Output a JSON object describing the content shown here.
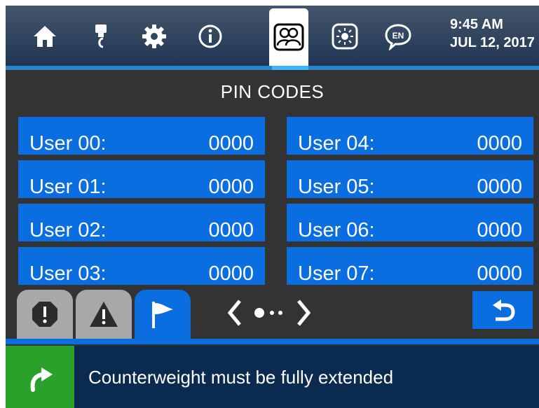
{
  "header": {
    "nav_items": [
      {
        "icon": "home-icon"
      },
      {
        "icon": "tool-icon"
      },
      {
        "icon": "gear-icon"
      },
      {
        "icon": "info-icon"
      },
      {
        "icon": "users-icon",
        "active": true
      },
      {
        "icon": "brightness-icon"
      },
      {
        "icon": "language-icon",
        "text": "EN"
      }
    ],
    "time": "9:45 AM",
    "date": "JUL 12, 2017"
  },
  "page": {
    "title": "PIN CODES"
  },
  "pins": [
    {
      "label": "User 00:",
      "value": "0000"
    },
    {
      "label": "User 01:",
      "value": "0000"
    },
    {
      "label": "User 02:",
      "value": "0000"
    },
    {
      "label": "User 03:",
      "value": "0000"
    },
    {
      "label": "User 04:",
      "value": "0000"
    },
    {
      "label": "User 05:",
      "value": "0000"
    },
    {
      "label": "User 06:",
      "value": "0000"
    },
    {
      "label": "User 07:",
      "value": "0000"
    }
  ],
  "tabs": [
    {
      "icon": "alarm-icon"
    },
    {
      "icon": "warning-icon"
    },
    {
      "icon": "flag-icon",
      "active": true
    }
  ],
  "pager": {
    "pages": 3,
    "current": 1
  },
  "status": {
    "icon": "turn-arrow-icon",
    "message": "Counterweight must be fully extended"
  },
  "colors": {
    "accent_blue": "#0a6ee0",
    "status_green": "#2aa12a",
    "header_dark": "#1f3553",
    "status_bar": "#0a2b4f",
    "background": "#333333"
  }
}
